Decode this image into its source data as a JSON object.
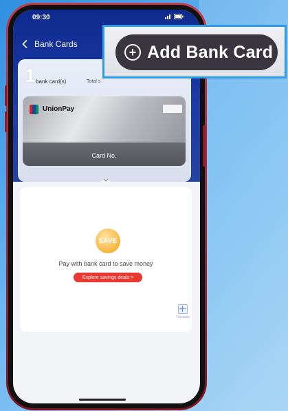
{
  "status_bar": {
    "time": "09:30"
  },
  "nav": {
    "title": "Bank Cards"
  },
  "summary": {
    "count": "1",
    "count_label": "bank card(s)",
    "total_label": "Total s"
  },
  "card": {
    "brand": "UnionPay",
    "number_label": "Card No.",
    "logo_colors": [
      "#d81e2a",
      "#0b4c9c",
      "#0b8a6b"
    ]
  },
  "promo": {
    "icon_text": "SAVE",
    "message": "Pay with bank card to save money",
    "cta_label": "Explore savings deals >"
  },
  "translate": {
    "label": "Translate"
  },
  "callout": {
    "label": "Add Bank Card"
  },
  "colors": {
    "header": "#1b3ca6",
    "cta": "#e8382f",
    "callout_border": "#2c9be8",
    "callout_button": "#3b3540"
  }
}
